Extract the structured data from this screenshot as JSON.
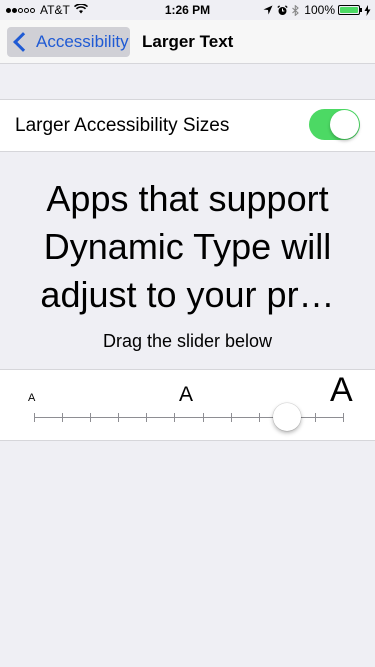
{
  "status_bar": {
    "carrier": "AT&T",
    "time": "1:26 PM",
    "battery": "100%",
    "signal_bars_filled": 2,
    "signal_bars_total": 5
  },
  "nav": {
    "back_label": "Accessibility",
    "title": "Larger Text"
  },
  "settings": {
    "larger_sizes_label": "Larger Accessibility Sizes",
    "larger_sizes_enabled": true
  },
  "preview": {
    "text": "Apps that support\nDynamic Type will\nadjust to your pr…",
    "hint": "Drag the slider below"
  },
  "slider": {
    "small_label": "A",
    "medium_label": "A",
    "large_label": "A",
    "steps": 12,
    "selected_step": 9
  },
  "colors": {
    "accent": "#1f5ad4",
    "switch_on": "#4cd964",
    "background": "#efeff4"
  }
}
